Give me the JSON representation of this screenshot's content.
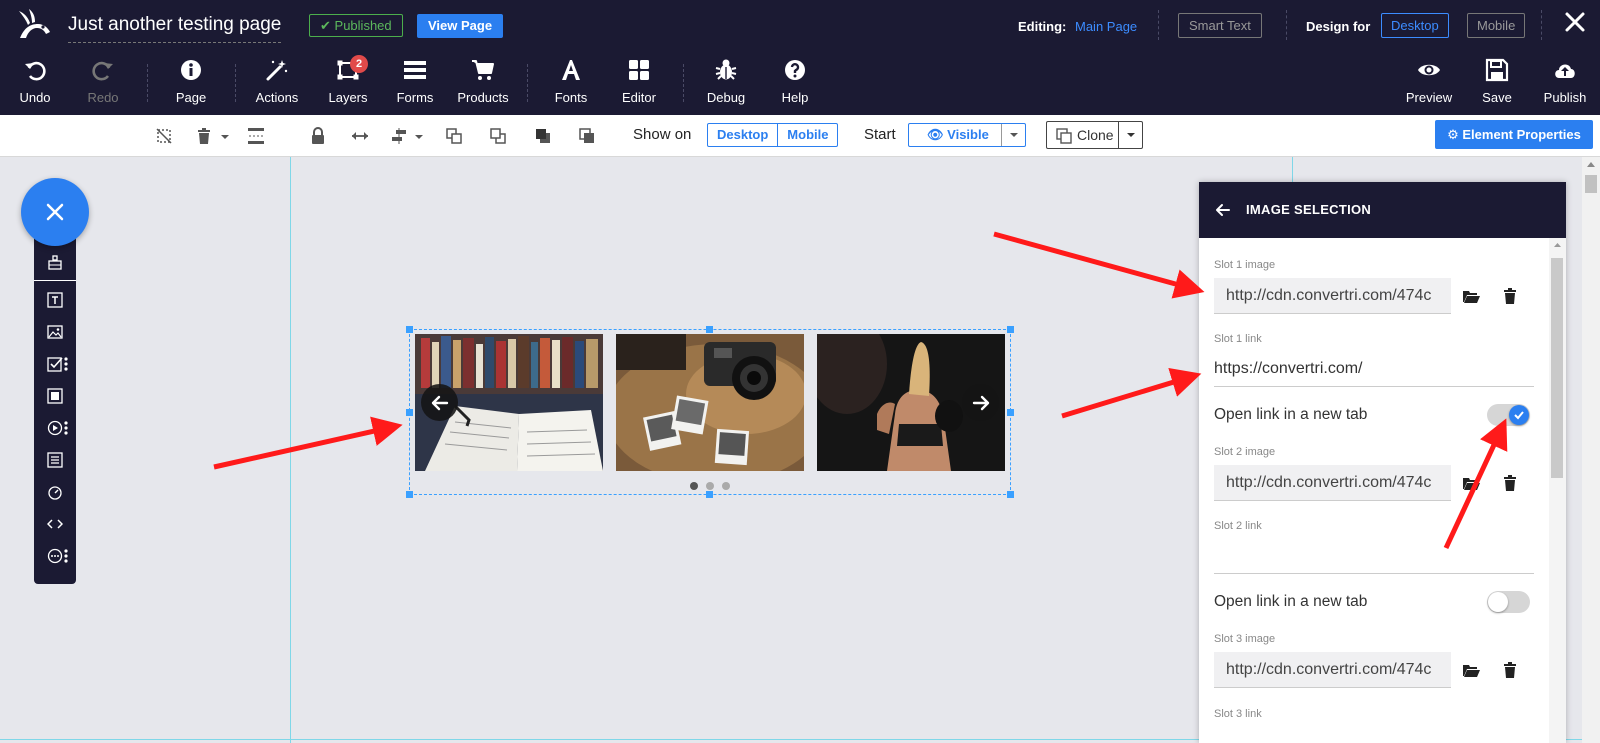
{
  "header": {
    "page_title": "Just another testing page",
    "published_label": "Published",
    "view_page_label": "View Page",
    "editing_label": "Editing:",
    "editing_value": "Main Page",
    "smart_text_label": "Smart Text",
    "design_for_label": "Design for",
    "design_desktop": "Desktop",
    "design_mobile": "Mobile"
  },
  "toolbar": {
    "undo": "Undo",
    "redo": "Redo",
    "page": "Page",
    "actions": "Actions",
    "layers": "Layers",
    "layers_count": "2",
    "forms": "Forms",
    "products": "Products",
    "fonts": "Fonts",
    "editor": "Editor",
    "debug": "Debug",
    "help": "Help",
    "preview": "Preview",
    "save": "Save",
    "publish": "Publish"
  },
  "subbar": {
    "show_on_label": "Show on",
    "show_desktop": "Desktop",
    "show_mobile": "Mobile",
    "start_label": "Start",
    "visible_label": "Visible",
    "clone_label": "Clone",
    "element_properties_label": "Element Properties"
  },
  "panel": {
    "title": "IMAGE SELECTION",
    "slot1_image_label": "Slot 1 image",
    "slot1_image_value": "http://cdn.convertri.com/474c",
    "slot1_link_label": "Slot 1 link",
    "slot1_link_value": "https://convertri.com/",
    "slot1_newtab_label": "Open link in a new tab",
    "slot2_image_label": "Slot 2 image",
    "slot2_image_value": "http://cdn.convertri.com/474c",
    "slot2_link_label": "Slot 2 link",
    "slot2_link_value": "",
    "slot2_newtab_label": "Open link in a new tab",
    "slot3_image_label": "Slot 3 image",
    "slot3_image_value": "http://cdn.convertri.com/474c",
    "slot3_link_label": "Slot 3 link"
  },
  "colors": {
    "header_bg": "#1b1a33",
    "accent_blue": "#2b7ff0",
    "published_green": "#5cb85c",
    "annotation_red": "#ff1a1a"
  }
}
